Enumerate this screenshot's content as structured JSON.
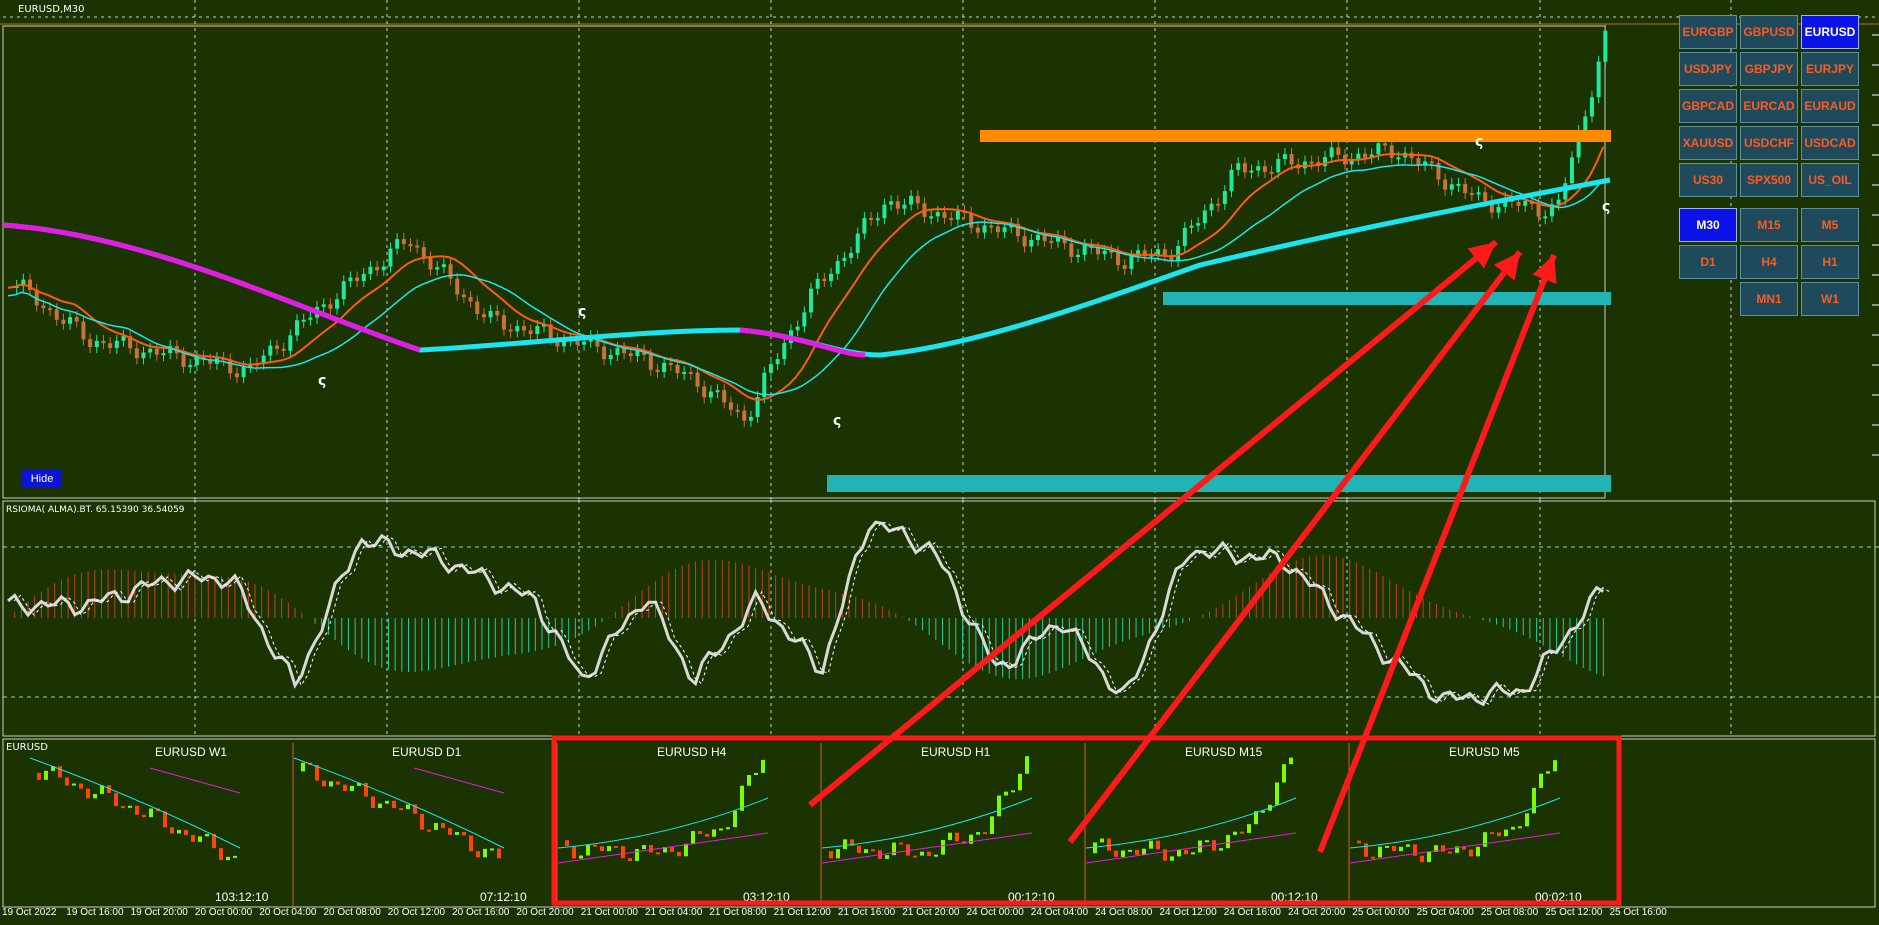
{
  "chart": {
    "title": "EURUSD,M30",
    "hide_label": "Hide"
  },
  "indicator": {
    "title": "RSIOMA( ALMA).BT. 65.15390 36.54059"
  },
  "mini_panel": {
    "symbol": "EURUSD",
    "charts": [
      {
        "title": "EURUSD W1",
        "timer": "103:12:10"
      },
      {
        "title": "EURUSD D1",
        "timer": "07:12:10"
      },
      {
        "title": "EURUSD H4",
        "timer": "03:12:10"
      },
      {
        "title": "EURUSD H1",
        "timer": "00:12:10"
      },
      {
        "title": "EURUSD M15",
        "timer": "00:12:10"
      },
      {
        "title": "EURUSD M5",
        "timer": "00:02:10"
      }
    ]
  },
  "symbols": [
    {
      "label": "EURGBP",
      "active": false
    },
    {
      "label": "GBPUSD",
      "active": false
    },
    {
      "label": "EURUSD",
      "active": true
    },
    {
      "label": "USDJPY",
      "active": false
    },
    {
      "label": "GBPJPY",
      "active": false
    },
    {
      "label": "EURJPY",
      "active": false
    },
    {
      "label": "GBPCAD",
      "active": false
    },
    {
      "label": "EURCAD",
      "active": false
    },
    {
      "label": "EURAUD",
      "active": false
    },
    {
      "label": "XAUUSD",
      "active": false
    },
    {
      "label": "USDCHF",
      "active": false
    },
    {
      "label": "USDCAD",
      "active": false
    },
    {
      "label": "US30",
      "active": false
    },
    {
      "label": "SPX500",
      "active": false
    },
    {
      "label": "US_OIL",
      "active": false
    }
  ],
  "timeframes": [
    {
      "label": "M30",
      "active": true
    },
    {
      "label": "M15",
      "active": false
    },
    {
      "label": "M5",
      "active": false
    },
    {
      "label": "D1",
      "active": false
    },
    {
      "label": "H4",
      "active": false
    },
    {
      "label": "H1",
      "active": false
    },
    {
      "label": "MN1",
      "active": false
    },
    {
      "label": "W1",
      "active": false
    }
  ],
  "time_axis": [
    "19 Oct 2022",
    "19 Oct 16:00",
    "19 Oct 20:00",
    "20 Oct 00:00",
    "20 Oct 04:00",
    "20 Oct 08:00",
    "20 Oct 12:00",
    "20 Oct 16:00",
    "20 Oct 20:00",
    "21 Oct 00:00",
    "21 Oct 04:00",
    "21 Oct 08:00",
    "21 Oct 12:00",
    "21 Oct 16:00",
    "21 Oct 20:00",
    "24 Oct 00:00",
    "24 Oct 04:00",
    "24 Oct 08:00",
    "24 Oct 12:00",
    "24 Oct 16:00",
    "24 Oct 20:00",
    "25 Oct 00:00",
    "25 Oct 04:00",
    "25 Oct 08:00",
    "25 Oct 12:00",
    "25 Oct 16:00"
  ],
  "colors": {
    "background": "#1a3300",
    "bull_candle": "#1de9a0",
    "bear_candle": "#c8733a",
    "ma_fast": "#ff5a14",
    "ma_slow_up": "#19e6f2",
    "ma_slow_down": "#e619e6",
    "resistance": "#ff8c00",
    "support": "#21b4b4",
    "arrow": "#ff1a1a",
    "button_bg": "#1f4a5c",
    "button_text": "#ff5a1f",
    "button_active": "#0a12e6"
  }
}
